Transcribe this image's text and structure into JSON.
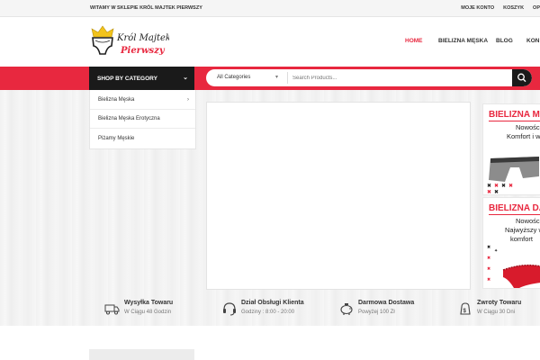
{
  "topbar": {
    "welcome": "WITAMY W SKLEPIE KRÓL MAJTEK PIERWSZY",
    "links": [
      "MOJE KONTO",
      "KOSZYK",
      "OP"
    ]
  },
  "logo": {
    "line1": "Król Majtek",
    "line2": "Pierwszy"
  },
  "nav": {
    "items": [
      "HOME",
      "BIELIZNA MĘSKA",
      "BLOG",
      "KON"
    ],
    "active": "HOME"
  },
  "category_menu": {
    "heading": "SHOP BY CATEGORY",
    "items": [
      "Bielizna Męska",
      "Bielizna Męska Erotyczna",
      "Piżamy Męskie"
    ]
  },
  "search": {
    "category": "All Categories",
    "placeholder": "Search Products..."
  },
  "banners": [
    {
      "title": "BIELIZNA M",
      "line1": "Nowośc",
      "line2": "Komfort i wy"
    },
    {
      "title": "BIELIZNA DA",
      "line1": "Nowośc",
      "line2": "Najwyższy w",
      "line3": "komfort"
    }
  ],
  "features": [
    {
      "icon": "truck-icon",
      "title": "Wysyłka Towaru",
      "subtitle": "W Ciągu 48 Godzin"
    },
    {
      "icon": "headset-icon",
      "title": "Dział Obsługi Klienta",
      "subtitle": "Godziny : 8:00 - 20:00"
    },
    {
      "icon": "piggy-bank-icon",
      "title": "Darmowa Dostawa",
      "subtitle": "Powyżej 100 Zł"
    },
    {
      "icon": "money-icon",
      "title": "Zwroty Towaru",
      "subtitle": "W Ciągu 30 Dni"
    }
  ],
  "colors": {
    "accent": "#e8283f",
    "dark": "#1a1a1a"
  }
}
